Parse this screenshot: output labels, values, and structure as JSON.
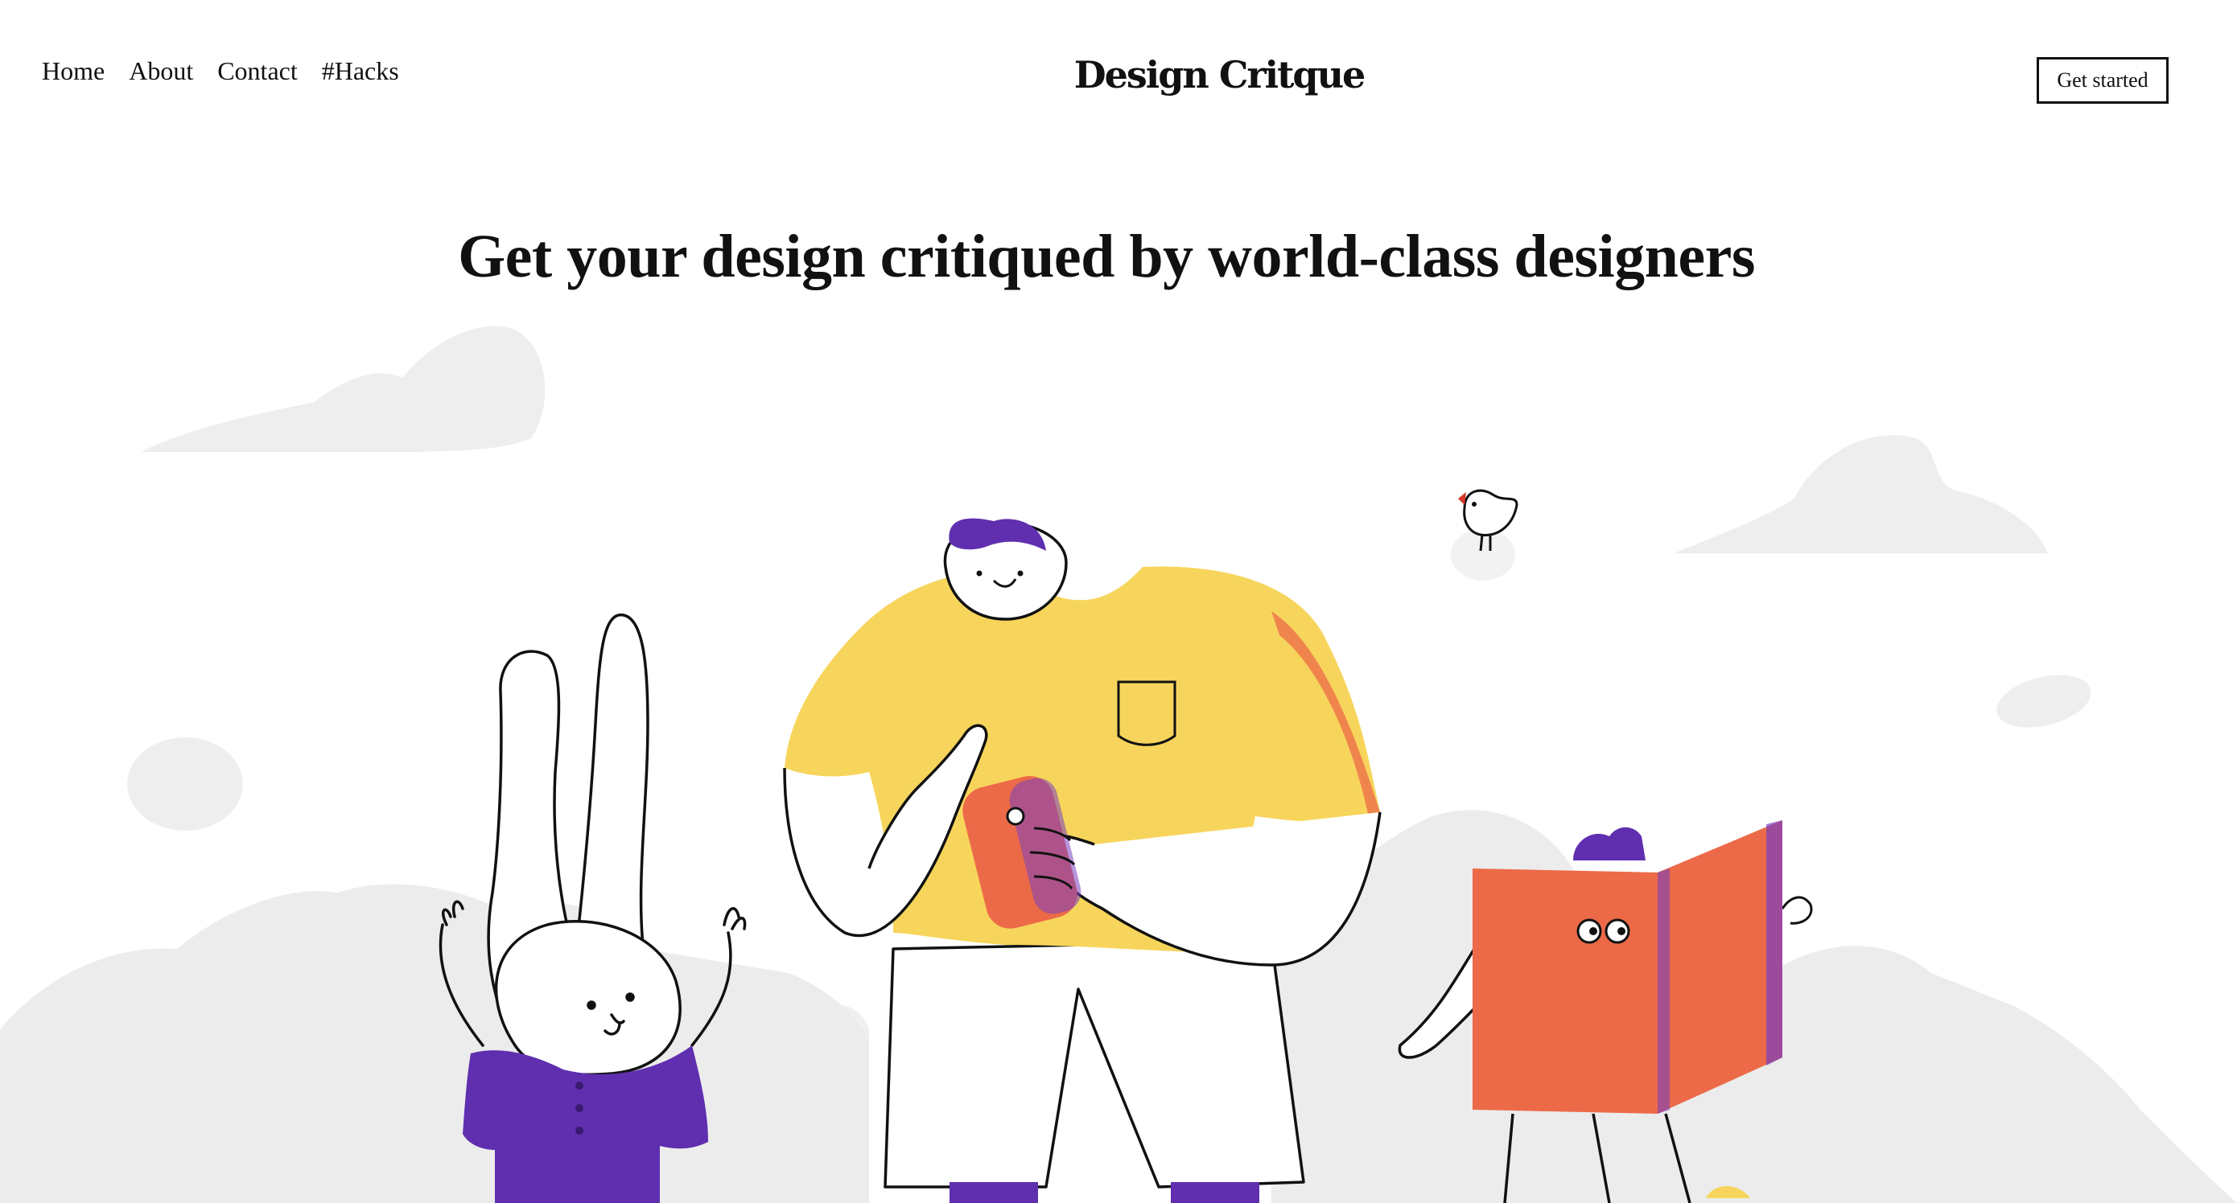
{
  "nav": {
    "items": [
      {
        "label": "Home"
      },
      {
        "label": "About"
      },
      {
        "label": "Contact"
      },
      {
        "label": "#Hacks"
      }
    ]
  },
  "brand": {
    "title": "Design Critque"
  },
  "header": {
    "cta_label": "Get started"
  },
  "hero": {
    "title": "Get your design critiqued by world-class designers"
  },
  "colors": {
    "text": "#111111",
    "background": "#ffffff",
    "yellow": "#f7d55c",
    "orange": "#ec6a48",
    "purple": "#5f2fb0",
    "cloud_gray": "#ececec"
  },
  "illustration": {
    "characters": [
      "rabbit",
      "man-with-phone",
      "reader-with-book",
      "bird"
    ]
  }
}
